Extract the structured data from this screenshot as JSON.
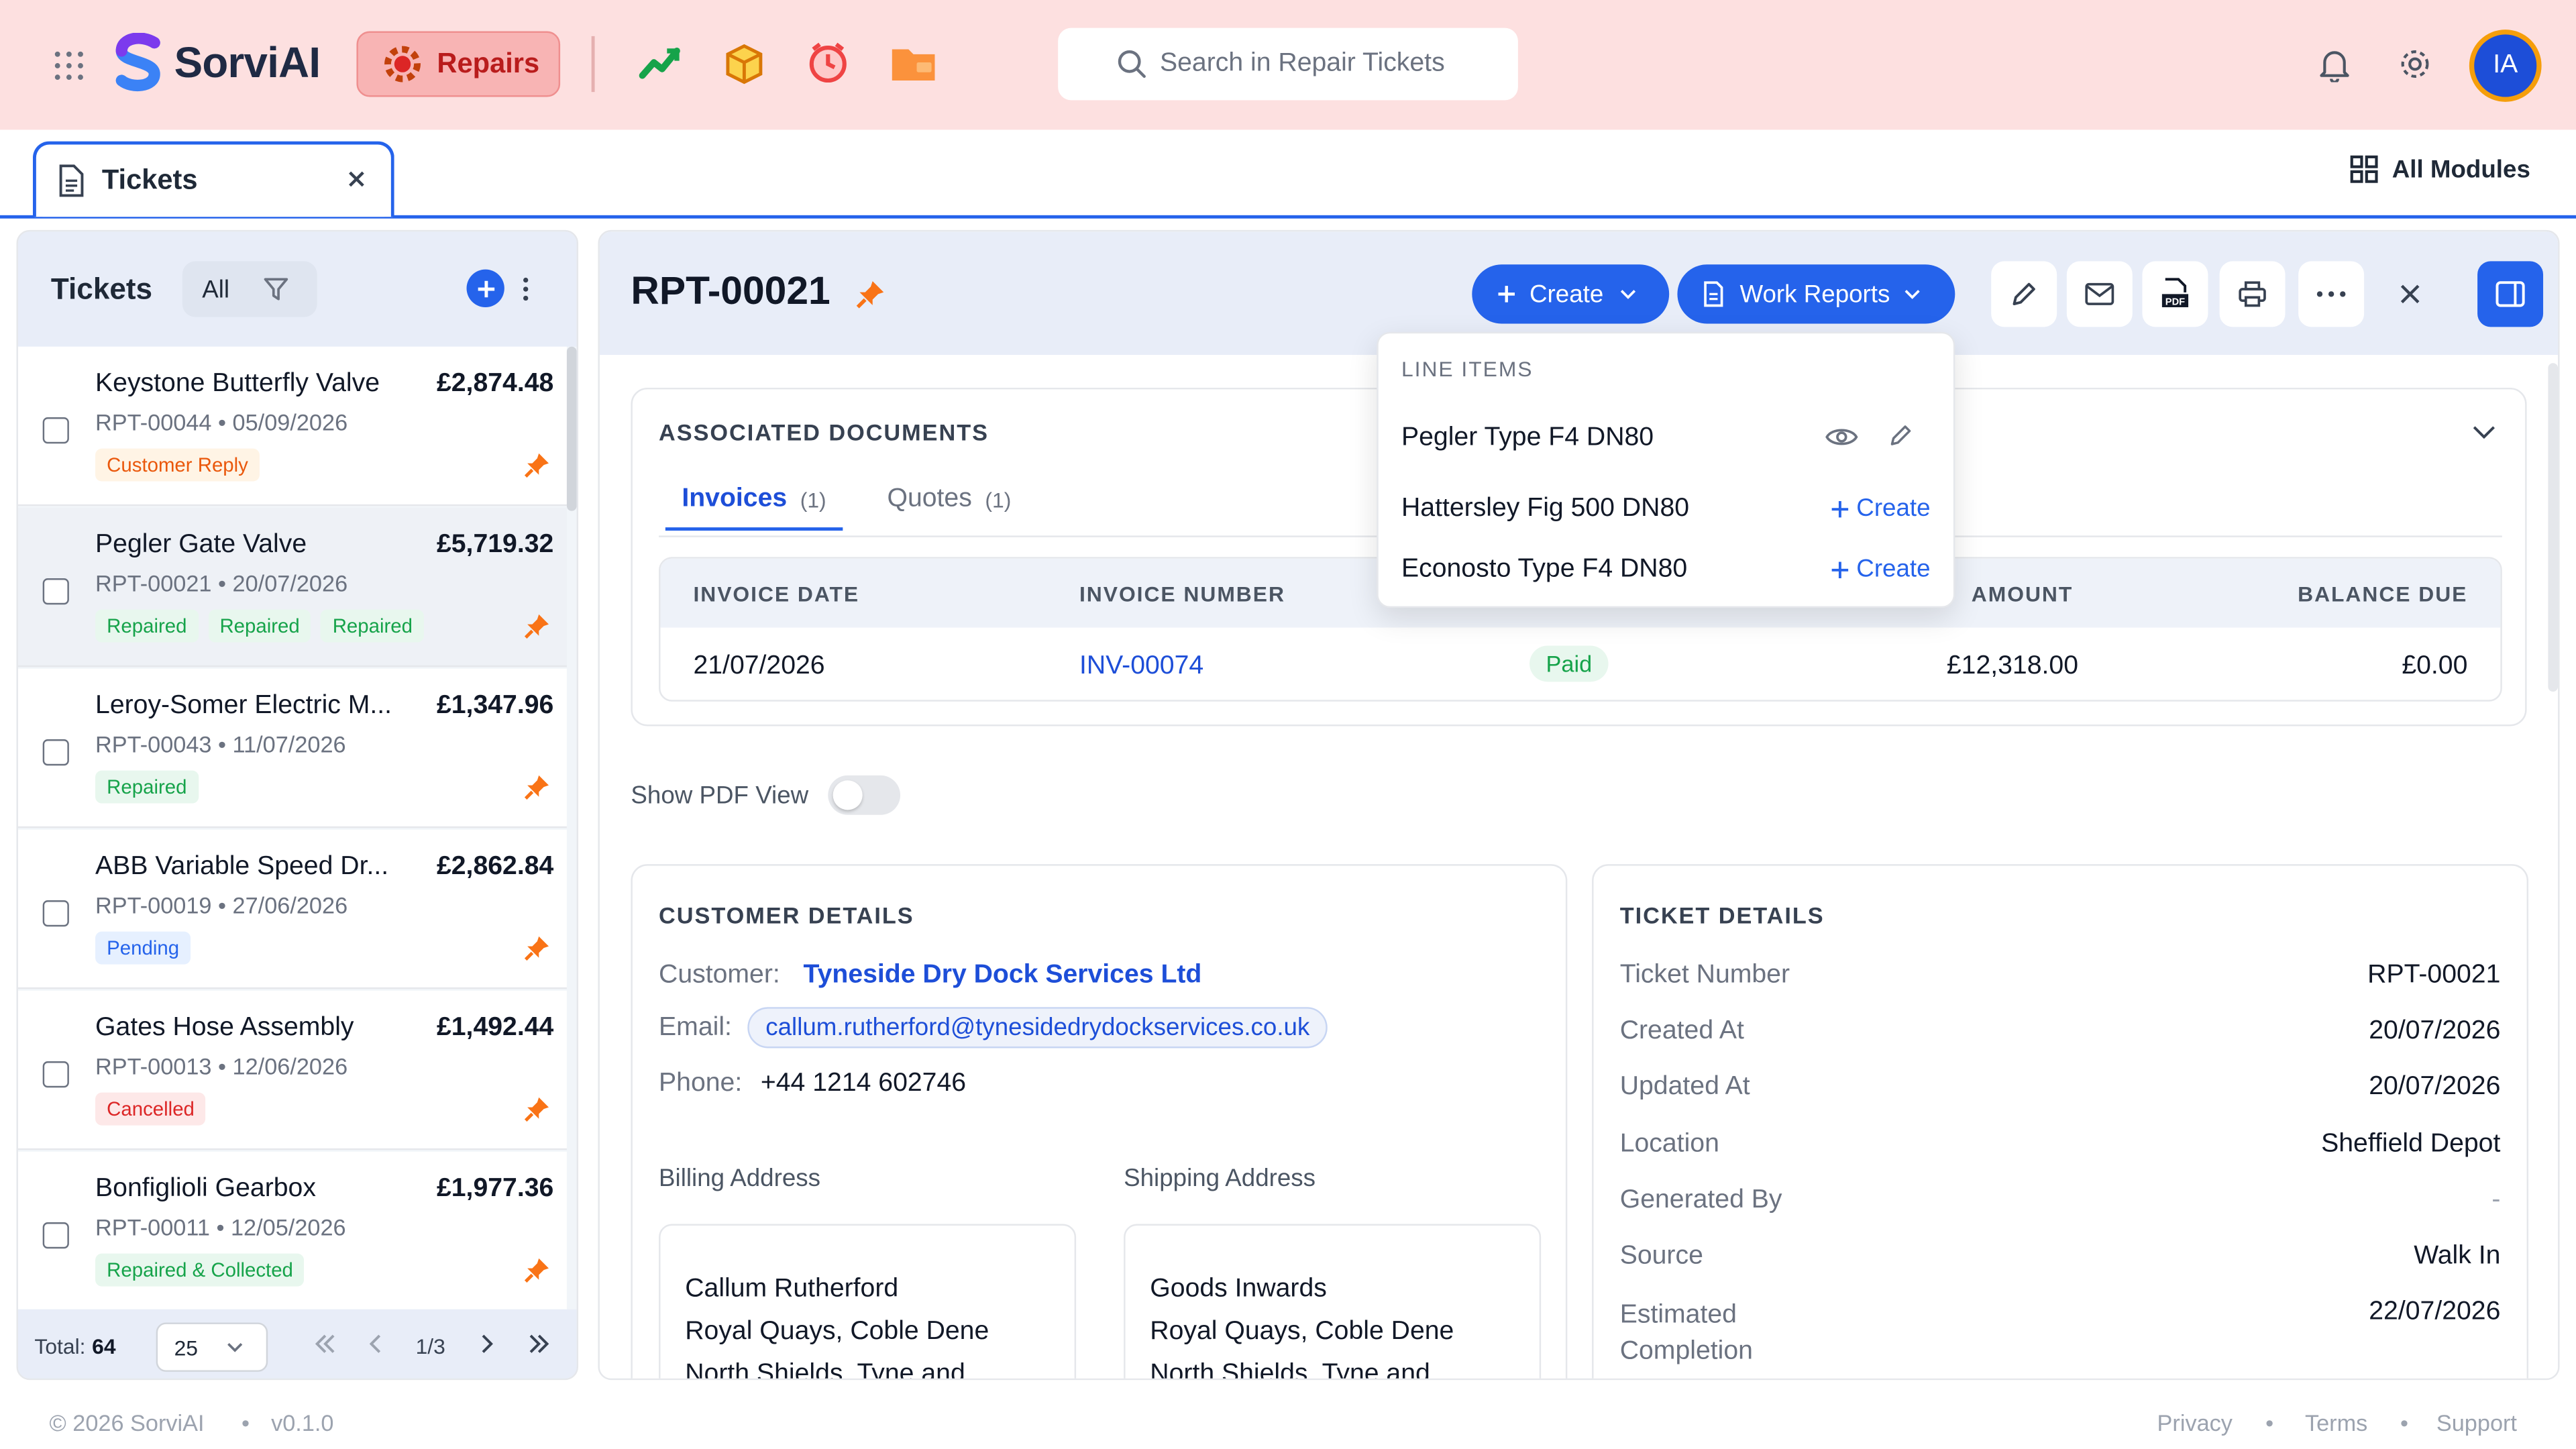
{
  "brand": {
    "name": "SorviAI"
  },
  "header": {
    "module_label": "Repairs",
    "search_placeholder": "Search in Repair Tickets",
    "user_initials": "IA",
    "quick_icons": [
      "chart-icon",
      "box-icon",
      "alarm-icon",
      "folder-icon"
    ]
  },
  "tabs": {
    "active_tab": "Tickets",
    "all_modules": "All Modules"
  },
  "list": {
    "title": "Tickets",
    "filter_all": "All",
    "items": [
      {
        "title": "Keystone Butterfly Valve",
        "amount": "£2,874.48",
        "ref": "RPT-00044 • 05/09/2026",
        "badges": [
          {
            "text": "Customer Reply",
            "tone": "orange"
          }
        ]
      },
      {
        "title": "Pegler Gate Valve",
        "amount": "£5,719.32",
        "ref": "RPT-00021 • 20/07/2026",
        "badges": [
          {
            "text": "Repaired",
            "tone": "green"
          },
          {
            "text": "Repaired",
            "tone": "green"
          },
          {
            "text": "Repaired",
            "tone": "green"
          }
        ]
      },
      {
        "title": "Leroy-Somer Electric M...",
        "amount": "£1,347.96",
        "ref": "RPT-00043 • 11/07/2026",
        "badges": [
          {
            "text": "Repaired",
            "tone": "green"
          }
        ]
      },
      {
        "title": "ABB Variable Speed Dr...",
        "amount": "£2,862.84",
        "ref": "RPT-00019 • 27/06/2026",
        "badges": [
          {
            "text": "Pending",
            "tone": "blue"
          }
        ]
      },
      {
        "title": "Gates Hose Assembly",
        "amount": "£1,492.44",
        "ref": "RPT-00013 • 12/06/2026",
        "badges": [
          {
            "text": "Cancelled",
            "tone": "red"
          }
        ]
      },
      {
        "title": "Bonfiglioli Gearbox",
        "amount": "£1,977.36",
        "ref": "RPT-00011 • 12/05/2026",
        "badges": [
          {
            "text": "Repaired & Collected",
            "tone": "green"
          }
        ]
      }
    ],
    "footer": {
      "total_label": "Total:",
      "total_value": "64",
      "page_size": "25",
      "page": "1/3"
    }
  },
  "detail": {
    "ticket_id": "RPT-00021",
    "create_label": "Create",
    "work_reports_label": "Work Reports",
    "associated_documents": {
      "title": "ASSOCIATED DOCUMENTS",
      "tabs": [
        {
          "label": "Invoices",
          "count": "(1)"
        },
        {
          "label": "Quotes",
          "count": "(1)"
        }
      ],
      "columns": [
        "INVOICE DATE",
        "INVOICE NUMBER",
        "AMOUNT",
        "BALANCE DUE"
      ],
      "rows": [
        {
          "date": "21/07/2026",
          "number": "INV-00074",
          "status": "Paid",
          "amount": "£12,318.00",
          "balance": "£0.00"
        }
      ]
    },
    "line_items_dropdown": {
      "title": "LINE ITEMS",
      "items": [
        {
          "name": "Pegler Type F4 DN80"
        },
        {
          "name": "Hattersley Fig 500 DN80",
          "action": "Create"
        },
        {
          "name": "Econosto Type F4 DN80",
          "action": "Create"
        }
      ]
    },
    "show_pdf_label": "Show PDF View",
    "customer": {
      "title": "CUSTOMER DETAILS",
      "customer_label": "Customer:",
      "customer_value": "Tyneside Dry Dock Services Ltd",
      "email_label": "Email:",
      "email_value": "callum.rutherford@tynesidedrydockservices.co.uk",
      "phone_label": "Phone:",
      "phone_value": "+44 1214 602746",
      "billing_label": "Billing Address",
      "billing_lines": [
        "Callum Rutherford",
        "Royal Quays, Coble Dene",
        "North Shields, Tyne and"
      ],
      "shipping_label": "Shipping Address",
      "shipping_lines": [
        "Goods Inwards",
        "Royal Quays, Coble Dene",
        "North Shields, Tyne and"
      ]
    },
    "ticket_details": {
      "title": "TICKET DETAILS",
      "rows": [
        {
          "label": "Ticket Number",
          "value": "RPT-00021"
        },
        {
          "label": "Created At",
          "value": "20/07/2026"
        },
        {
          "label": "Updated At",
          "value": "20/07/2026"
        },
        {
          "label": "Location",
          "value": "Sheffield Depot"
        },
        {
          "label": "Generated By",
          "value": "-"
        },
        {
          "label": "Source",
          "value": "Walk In"
        },
        {
          "label": "Estimated Completion",
          "value": "22/07/2026"
        }
      ]
    }
  },
  "footer": {
    "copyright": "© 2026 SorviAI",
    "version": "v0.1.0",
    "links": [
      "Privacy",
      "Terms",
      "Support"
    ]
  },
  "colors": {
    "accent": "#2563eb",
    "header_bg": "#fde0e0",
    "module_btn": "#f8b4b4",
    "pin": "#f97316"
  }
}
